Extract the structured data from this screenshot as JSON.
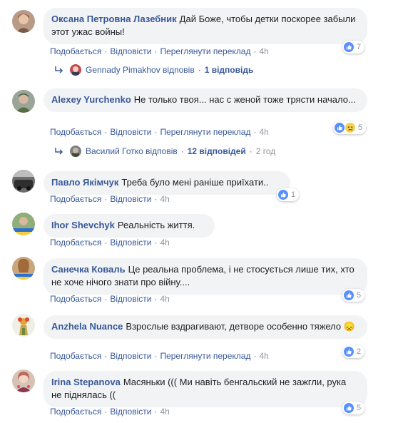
{
  "action_labels": {
    "like": "Подобається",
    "reply": "Відповісти",
    "translate": "Переглянути переклад"
  },
  "separator": "·",
  "comments": [
    {
      "author": "Оксана Петровна Лазебник",
      "text": "Дай Боже, чтобы детки поскорее забыли этот ужас войны!",
      "time": "4h",
      "reaction_count": "7",
      "has_translate": true,
      "reactions": [
        "like-reaction-icon"
      ],
      "reply": {
        "name": "Gennady Pimakhov відповів",
        "count": "1 відповідь",
        "time": ""
      }
    },
    {
      "author": "Alexey Yurchenko",
      "text": "Не только твоя... нас с женой тоже трясти начало...",
      "time": "4h",
      "reaction_count": "5",
      "has_translate": true,
      "reactions": [
        "like-reaction-icon",
        "sad-reaction-icon"
      ],
      "reply": {
        "name": "Василий Готко відповів",
        "count": "12 відповідей",
        "time": "2 год"
      }
    },
    {
      "author": "Павло Якімчук",
      "text": "Треба було мені раніше приїхати..",
      "time": "4h",
      "reaction_count": "1",
      "has_translate": false,
      "reactions": [
        "like-reaction-icon"
      ]
    },
    {
      "author": "Ihor Shevchyk",
      "text": "Реальність життя.",
      "time": "4h",
      "reaction_count": "",
      "has_translate": false,
      "reactions": []
    },
    {
      "author": "Санечка Коваль",
      "text": "Це реальна проблема, і не стосується лише тих, хто не хоче нічого знати про війну....",
      "time": "4h",
      "reaction_count": "5",
      "has_translate": false,
      "reactions": [
        "like-reaction-icon"
      ]
    },
    {
      "author": "Anzhela Nuance",
      "text": "Взрослые вздрагивают, детворе особенно тяжело 😞",
      "time": "4h",
      "reaction_count": "2",
      "has_translate": true,
      "reactions": [
        "like-reaction-icon"
      ]
    },
    {
      "author": "Irina Stepanova",
      "text": "Масяньки ((( Ми навіть бенгальский не зажгли, рука не піднялась ((",
      "time": "4h",
      "reaction_count": "5",
      "has_translate": false,
      "reactions": [
        "like-reaction-icon"
      ]
    }
  ],
  "colors": {
    "link": "#385898",
    "bubble_bg": "#f2f3f5",
    "meta": "#90949c",
    "like_blue": "#5890ff",
    "sad_yellow": "#f7d04a"
  }
}
